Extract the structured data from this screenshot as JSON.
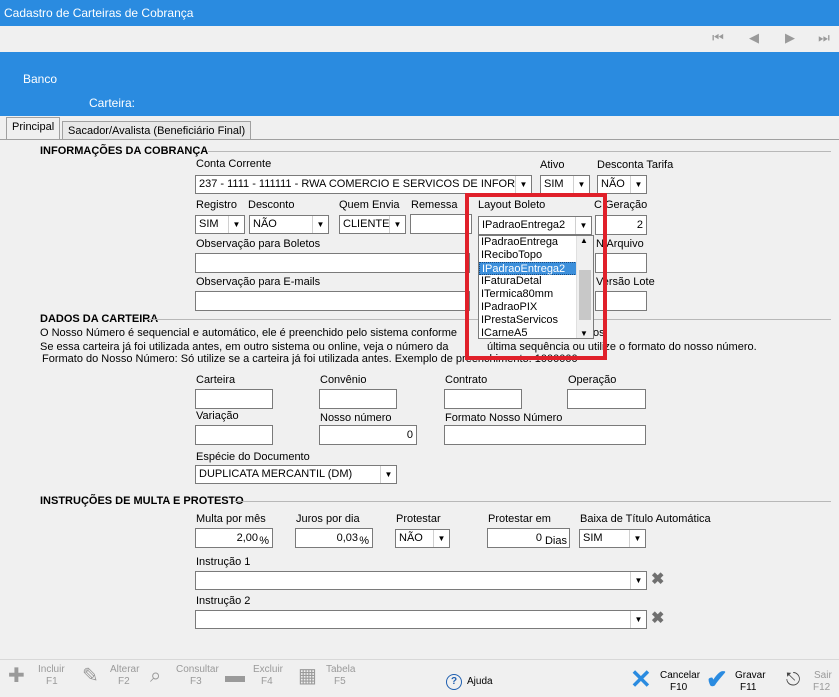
{
  "window": {
    "title": "Cadastro de Carteiras de Cobrança"
  },
  "banner": {
    "banco_label": "Banco",
    "carteira_label": "Carteira:"
  },
  "tabs": [
    {
      "label": "Principal"
    },
    {
      "label": "Sacador/Avalista (Beneficiário Final)"
    }
  ],
  "cobranca": {
    "section_title": "INFORMAÇÕES DA COBRANÇA",
    "conta_corrente_label": "Conta Corrente",
    "conta_corrente_value": "237 - 1111 - 111111 - RWA COMERCIO E SERVICOS DE INFORMATICA",
    "ativo_label": "Ativo",
    "ativo_value": "SIM",
    "desconta_tarifa_label": "Desconta Tarifa",
    "desconta_tarifa_value": "NÃO",
    "registro_label": "Registro",
    "registro_value": "SIM",
    "desconto_label": "Desconto",
    "desconto_value": "NÃO",
    "quem_envia_label": "Quem Envia",
    "quem_envia_value": "CLIENTE",
    "remessa_label": "Remessa",
    "layout_label": "Layout Boleto",
    "layout_value": "IPadraoEntrega2",
    "geracao_label": "C Geração",
    "geracao_value": "2",
    "obs_boletos_label": "Observação para Boletos",
    "nr_arquivo_label": "N Arquivo",
    "obs_emails_label": "Observação para E-mails",
    "versao_lote_label": "Versão Lote",
    "layout_options": [
      "IPadraoEntrega",
      "IReciboTopo",
      "IPadraoEntrega2",
      "IFaturaDetal",
      "ITermica80mm",
      "IPadraoPIX",
      "IPrestaServicos",
      "ICarneA5"
    ],
    "layout_selected_index": 2
  },
  "carteira": {
    "section_title": "DADOS DA CARTEIRA",
    "info_line1": "O Nosso Número é sequencial e automático, ele é preenchido pelo sistema conforme",
    "info_line1_end": "os",
    "info_line2a": "Se essa carteira já foi utilizada antes, em outro sistema ou online, veja o número da",
    "info_line2b": "última sequência ou utilize o formato do nosso número.",
    "info_line3": "Formato do Nosso Número: Só utilize se a carteira já foi utilizada antes. Exemplo de preenchimento: 1000000",
    "carteira_label": "Carteira",
    "convenio_label": "Convênio",
    "contrato_label": "Contrato",
    "operacao_label": "Operação",
    "variacao_label": "Variação",
    "nosso_numero_label": "Nosso número",
    "nosso_numero_value": "0",
    "formato_label": "Formato Nosso Número",
    "especie_label": "Espécie do Documento",
    "especie_value": "DUPLICATA MERCANTIL (DM)"
  },
  "multa": {
    "section_title": "INSTRUÇÕES DE MULTA E PROTESTO",
    "multa_label": "Multa por mês",
    "multa_value": "2,00",
    "multa_suffix": "%",
    "juros_label": "Juros por dia",
    "juros_value": "0,03",
    "juros_suffix": "%",
    "protestar_label": "Protestar",
    "protestar_value": "NÃO",
    "protestar_em_label": "Protestar em",
    "protestar_em_value": "0",
    "protestar_em_suffix": "Dias",
    "baixa_label": "Baixa de Título Automática",
    "baixa_value": "SIM",
    "instrucao1_label": "Instrução 1",
    "instrucao2_label": "Instrução 2"
  },
  "toolbar": {
    "incluir": "Incluir",
    "incluir_key": "F1",
    "alterar": "Alterar",
    "alterar_key": "F2",
    "consultar": "Consultar",
    "consultar_key": "F3",
    "excluir": "Excluir",
    "excluir_key": "F4",
    "tabela": "Tabela",
    "tabela_key": "F5",
    "ajuda": "Ajuda",
    "cancelar": "Cancelar",
    "cancelar_key": "F10",
    "gravar": "Gravar",
    "gravar_key": "F11",
    "sair": "Sair",
    "sair_key": "F12"
  },
  "colors": {
    "accent": "#2a8be0",
    "highlight_border": "#e0202a",
    "selection": "#3c8fdb"
  }
}
